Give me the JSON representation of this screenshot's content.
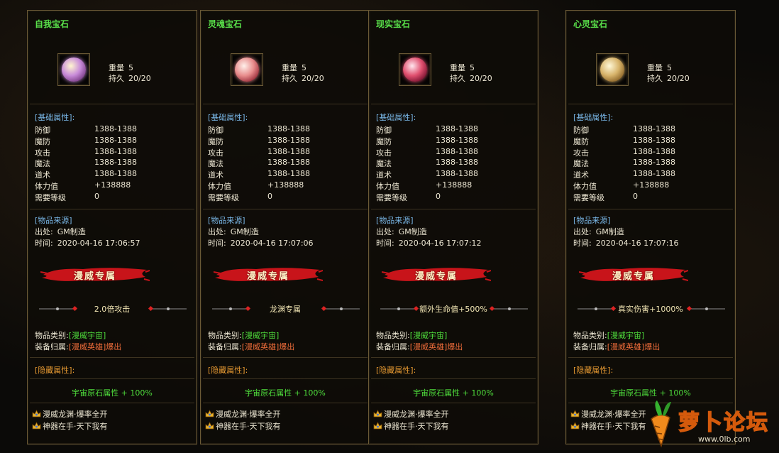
{
  "panels": [
    {
      "title": "自我宝石",
      "gem_colors": [
        "#fff6d0",
        "#c88bd9",
        "#7a3c86"
      ],
      "weight_label": "重量",
      "weight_value": "5",
      "durability_label": "持久",
      "durability_value": "20/20",
      "base_attr_title": "[基础属性]:",
      "attrs": [
        {
          "k": "防御",
          "v": "1388-1388"
        },
        {
          "k": "魔防",
          "v": "1388-1388"
        },
        {
          "k": "攻击",
          "v": "1388-1388"
        },
        {
          "k": "魔法",
          "v": "1388-1388"
        },
        {
          "k": "道术",
          "v": "1388-1388"
        },
        {
          "k": "体力值",
          "v": "+138888"
        },
        {
          "k": "需要等级",
          "v": "0"
        }
      ],
      "source_title": "[物品来源]",
      "origin_label": "出处:",
      "origin_value": "GM制造",
      "time_label": "时间:",
      "time_value": "2020-04-16 17:06:57",
      "banner_text": "漫威专属",
      "special": "2.0倍攻击",
      "category_label": "物品类别:",
      "category_value": "[漫威宇宙]",
      "owner_label": "装备归属:",
      "owner_value": "[漫威英雄]爆出",
      "hidden_title": "[隐藏属性]:",
      "hidden_value": "宇宙原石属性 + 100%",
      "foot1": "漫威龙渊·爆率全开",
      "foot2": "神器在手·天下我有"
    },
    {
      "title": "灵魂宝石",
      "gem_colors": [
        "#fff0ea",
        "#e88d8d",
        "#9a2d3a"
      ],
      "weight_label": "重量",
      "weight_value": "5",
      "durability_label": "持久",
      "durability_value": "20/20",
      "base_attr_title": "[基础属性]:",
      "attrs": [
        {
          "k": "防御",
          "v": "1388-1388"
        },
        {
          "k": "魔防",
          "v": "1388-1388"
        },
        {
          "k": "攻击",
          "v": "1388-1388"
        },
        {
          "k": "魔法",
          "v": "1388-1388"
        },
        {
          "k": "道术",
          "v": "1388-1388"
        },
        {
          "k": "体力值",
          "v": "+138888"
        },
        {
          "k": "需要等级",
          "v": "0"
        }
      ],
      "source_title": "[物品来源]",
      "origin_label": "出处:",
      "origin_value": "GM制造",
      "time_label": "时间:",
      "time_value": "2020-04-16 17:07:06",
      "banner_text": "漫威专属",
      "special": "龙渊专属",
      "category_label": "物品类别:",
      "category_value": "[漫威宇宙]",
      "owner_label": "装备归属:",
      "owner_value": "[漫威英雄]爆出",
      "hidden_title": "[隐藏属性]:",
      "hidden_value": "宇宙原石属性 + 100%",
      "foot1": "漫威龙渊·爆率全开",
      "foot2": "神器在手·天下我有"
    },
    {
      "title": "现实宝石",
      "gem_colors": [
        "#ffe6ee",
        "#e0506f",
        "#7a1230"
      ],
      "weight_label": "重量",
      "weight_value": "5",
      "durability_label": "持久",
      "durability_value": "20/20",
      "base_attr_title": "[基础属性]:",
      "attrs": [
        {
          "k": "防御",
          "v": "1388-1388"
        },
        {
          "k": "魔防",
          "v": "1388-1388"
        },
        {
          "k": "攻击",
          "v": "1388-1388"
        },
        {
          "k": "魔法",
          "v": "1388-1388"
        },
        {
          "k": "道术",
          "v": "1388-1388"
        },
        {
          "k": "体力值",
          "v": "+138888"
        },
        {
          "k": "需要等级",
          "v": "0"
        }
      ],
      "source_title": "[物品来源]",
      "origin_label": "出处:",
      "origin_value": "GM制造",
      "time_label": "时间:",
      "time_value": "2020-04-16 17:07:12",
      "banner_text": "漫威专属",
      "special": "额外生命值+500%",
      "category_label": "物品类别:",
      "category_value": "[漫威宇宙]",
      "owner_label": "装备归属:",
      "owner_value": "[漫威英雄]爆出",
      "hidden_title": "[隐藏属性]:",
      "hidden_value": "宇宙原石属性 + 100%",
      "foot1": "漫威龙渊·爆率全开",
      "foot2": "神器在手·天下我有"
    },
    {
      "title": "心灵宝石",
      "gem_colors": [
        "#fff8d8",
        "#d7b36a",
        "#8a6226"
      ],
      "weight_label": "重量",
      "weight_value": "5",
      "durability_label": "持久",
      "durability_value": "20/20",
      "base_attr_title": "[基础属性]:",
      "attrs": [
        {
          "k": "防御",
          "v": "1388-1388"
        },
        {
          "k": "魔防",
          "v": "1388-1388"
        },
        {
          "k": "攻击",
          "v": "1388-1388"
        },
        {
          "k": "魔法",
          "v": "1388-1388"
        },
        {
          "k": "道术",
          "v": "1388-1388"
        },
        {
          "k": "体力值",
          "v": "+138888"
        },
        {
          "k": "需要等级",
          "v": "0"
        }
      ],
      "source_title": "[物品来源]",
      "origin_label": "出处:",
      "origin_value": "GM制造",
      "time_label": "时间:",
      "time_value": "2020-04-16 17:07:16",
      "banner_text": "漫威专属",
      "special": "真实伤害+1000%",
      "category_label": "物品类别:",
      "category_value": "[漫威宇宙]",
      "owner_label": "装备归属:",
      "owner_value": "[漫威英雄]爆出",
      "hidden_title": "[隐藏属性]:",
      "hidden_value": "宇宙原石属性 + 100%",
      "foot1": "漫威龙渊·爆率全开",
      "foot2": "神器在手·天下我有"
    }
  ],
  "watermark": {
    "brand": "萝卜论坛",
    "site": "www.0lb.com"
  },
  "colors": {
    "title_green": "#59e04a",
    "section_blue": "#7ab8e8",
    "value_green": "#4fde3c",
    "value_orange": "#ef6d3a",
    "hidden_orange": "#e79a32",
    "banner_red": "#c8141a"
  }
}
